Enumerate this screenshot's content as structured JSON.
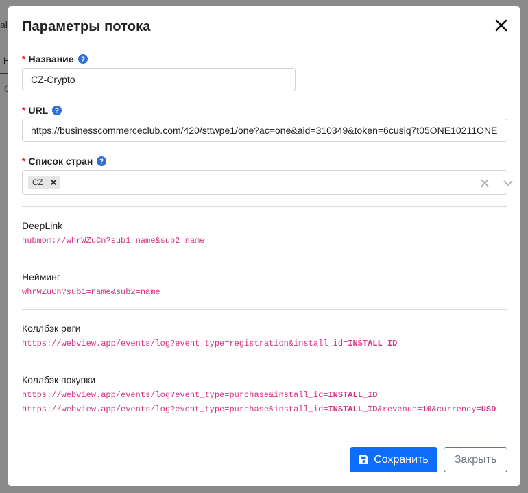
{
  "background": {
    "fragment_1": "al",
    "fragment_2": "Н",
    "fragment_3": "С"
  },
  "modal": {
    "title": "Параметры потока",
    "name_field": {
      "label": "Название",
      "required_mark": "*",
      "value": "CZ-Crypto"
    },
    "url_field": {
      "label": "URL",
      "required_mark": "*",
      "value": "https://businesscommerceclub.com/420/sttwpe1/one?ac=one&aid=310349&token=6cusiq7t05ONE10211ONE"
    },
    "countries_field": {
      "label": "Список стран",
      "required_mark": "*",
      "selected": [
        "CZ"
      ]
    },
    "deeplink": {
      "label": "DeepLink",
      "value": "hubmom://whrWZuCn?sub1=name&sub2=name"
    },
    "naming": {
      "label": "Нейминг",
      "value": "whrWZuCn?sub1=name&sub2=name"
    },
    "callback_registration": {
      "label": "Коллбэк реги",
      "value_prefix": "https://webview.app/events/log?event_type=registration&install_id=",
      "value_token": "INSTALL_ID"
    },
    "callback_purchase": {
      "label": "Коллбэк покупки",
      "line1_prefix": "https://webview.app/events/log?event_type=purchase&install_id=",
      "line1_token": "INSTALL_ID",
      "line2_prefix": "https://webview.app/events/log?event_type=purchase&install_id=",
      "line2_token": "INSTALL_ID",
      "line2_mid": "&revenue=",
      "line2_revenue": "10",
      "line2_mid2": "&currency=",
      "line2_currency": "USD"
    },
    "buttons": {
      "save": "Сохранить",
      "close": "Закрыть"
    }
  },
  "colors": {
    "primary": "#0d6efd",
    "required": "#e02020",
    "code": "#d63384",
    "help_icon": "#2f6fd6"
  }
}
